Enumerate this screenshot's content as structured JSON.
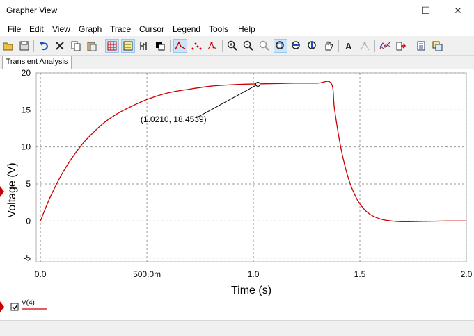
{
  "window": {
    "title": "Grapher View",
    "minimize_glyph": "—",
    "maximize_glyph": "☐",
    "close_glyph": "✕"
  },
  "menu": [
    "File",
    "Edit",
    "View",
    "Graph",
    "Trace",
    "Cursor",
    "Legend",
    "Tools",
    "Help"
  ],
  "toolbar": {
    "icons": [
      "open-icon",
      "save-icon",
      "undo-icon",
      "cut-icon",
      "copy-icon",
      "paste-icon",
      "grid-icon",
      "legend-icon",
      "properties-icon",
      "reverse-colors-icon",
      "lines-icon",
      "points-icon",
      "lines-points-icon",
      "zoom-in-icon",
      "zoom-out-icon",
      "zoom-full-icon",
      "zoom-area-icon",
      "zoom-x-icon",
      "zoom-y-icon",
      "pan-icon",
      "text-icon",
      "label-icon",
      "overlay-icon",
      "export-icon",
      "page-icon",
      "copy-graph-icon"
    ],
    "active": [
      "grid-icon",
      "legend-icon",
      "lines-icon",
      "zoom-area-icon"
    ]
  },
  "tabs": [
    {
      "label": "Transient Analysis",
      "active": true
    }
  ],
  "annotation": {
    "text": "(1.0210, 18.4539)",
    "point": [
      1.021,
      18.4539
    ]
  },
  "legend": {
    "label": "V(4)",
    "checked": true,
    "color": "#cc0000"
  },
  "chart_data": {
    "type": "line",
    "title": "",
    "xlabel": "Time (s)",
    "ylabel": "Voltage (V)",
    "xlim": [
      -0.02,
      2.0
    ],
    "ylim": [
      -5.5,
      20
    ],
    "xticks": [
      0,
      0.5,
      1.0,
      1.5,
      2.0
    ],
    "xtick_labels": [
      "0.0",
      "500.0m",
      "1.0",
      "1.5",
      "2.0"
    ],
    "yticks": [
      -5,
      0,
      5,
      10,
      15,
      20
    ],
    "ytick_labels": [
      "-5",
      "0",
      "5",
      "10",
      "15",
      "20"
    ],
    "grid": true,
    "series": [
      {
        "name": "V(4)",
        "color": "#cc0000",
        "x": [
          0,
          0.02,
          0.05,
          0.1,
          0.15,
          0.2,
          0.25,
          0.3,
          0.35,
          0.4,
          0.5,
          0.6,
          0.7,
          0.8,
          0.9,
          1.0,
          1.1,
          1.2,
          1.3,
          1.365,
          1.38,
          1.4,
          1.42,
          1.45,
          1.48,
          1.5,
          1.53,
          1.56,
          1.6,
          1.65,
          1.7,
          1.8,
          1.9,
          2.0
        ],
        "values": [
          0,
          1.45,
          3.48,
          6.3,
          8.6,
          10.5,
          12.0,
          13.3,
          14.3,
          15.1,
          16.4,
          17.3,
          17.8,
          18.2,
          18.4,
          18.5,
          18.55,
          18.6,
          18.6,
          18.6,
          15.3,
          11.6,
          8.6,
          5.4,
          3.3,
          2.3,
          1.3,
          0.7,
          0.25,
          0.0,
          -0.1,
          -0.05,
          0.0,
          0.0
        ]
      }
    ]
  },
  "colors": {
    "accent": "#cc0000",
    "grid": "#9a9a9a",
    "active_button": "#cce4f7"
  }
}
